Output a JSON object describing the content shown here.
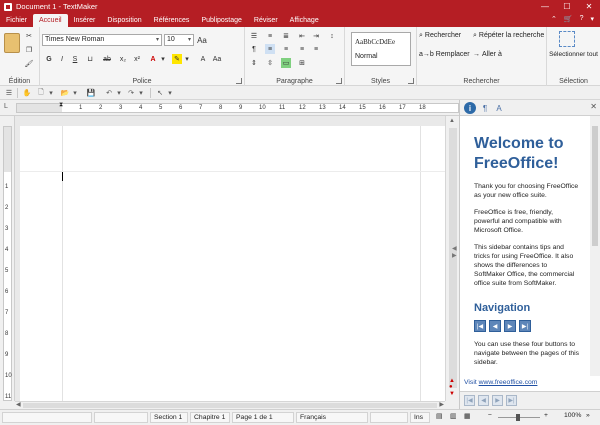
{
  "window": {
    "title": "Document 1 - TextMaker"
  },
  "menu": {
    "tabs": [
      "Fichier",
      "Accueil",
      "Insérer",
      "Disposition",
      "Références",
      "Publipostage",
      "Réviser",
      "Affichage"
    ],
    "active": "Accueil"
  },
  "ribbon": {
    "groups": {
      "edition": "Édition",
      "police": "Police",
      "paragraphe": "Paragraphe",
      "styles": "Styles",
      "rechercher": "Rechercher",
      "selection": "Sélection"
    },
    "font_name": "Times New Roman",
    "font_size": "10",
    "style_preview": "AaBbCcDdEe",
    "style_name": "Normal",
    "search": {
      "find": "Rechercher",
      "repeat": "Répéter la recherche",
      "replace": "Remplacer",
      "goto": "Aller à"
    },
    "select_all": "Sélectionner tout"
  },
  "ruler": {
    "numbers": [
      "1",
      "2",
      "3",
      "4",
      "5",
      "6",
      "7",
      "8",
      "9",
      "10",
      "11",
      "12",
      "13",
      "14",
      "15",
      "16",
      "17",
      "18"
    ]
  },
  "vruler": {
    "numbers": [
      "1",
      "2",
      "3",
      "4",
      "5",
      "6",
      "7",
      "8",
      "9",
      "10",
      "11"
    ]
  },
  "sidebar": {
    "heading": "Welcome to FreeOffice!",
    "p1": "Thank you for choosing FreeOffice as your new office suite.",
    "p2": "FreeOffice is free, friendly, powerful and compatible with Microsoft Office.",
    "p3": "This sidebar contains tips and tricks for using FreeOffice. It also shows the differences to SoftMaker Office, the commercial office suite from SoftMaker.",
    "nav_heading": "Navigation",
    "nav_text": "You can use these four buttons to navigate between the pages of this sidebar.",
    "link_prefix": "Visit ",
    "link_url": "www.freeoffice.com"
  },
  "statusbar": {
    "section": "Section 1",
    "chapter": "Chapitre 1",
    "page": "Page 1 de 1",
    "language": "Français",
    "mode": "Ins",
    "zoom": "100%"
  },
  "colors": {
    "accent": "#b51e24",
    "sidebar_heading": "#2f5f9a"
  }
}
